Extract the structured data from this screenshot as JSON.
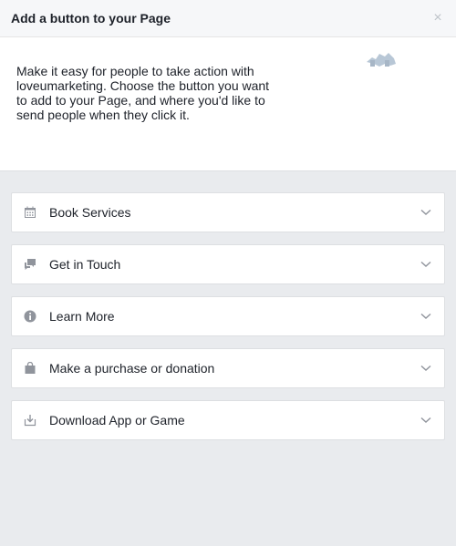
{
  "dialog": {
    "title": "Add a button to your Page",
    "close_label": "×",
    "intro_text": "Make it easy for people to take action with loveumarketing. Choose the button you want to add to your Page, and where you'd like to send people when they click it."
  },
  "options": [
    {
      "label": "Book Services",
      "icon": "calendar-icon"
    },
    {
      "label": "Get in Touch",
      "icon": "chat-icon"
    },
    {
      "label": "Learn More",
      "icon": "info-icon"
    },
    {
      "label": "Make a purchase or donation",
      "icon": "shopping-bag-icon"
    },
    {
      "label": "Download App or Game",
      "icon": "download-icon"
    }
  ],
  "colors": {
    "icon_gray": "#90949c",
    "background": "#e9ebee",
    "card": "#ffffff"
  }
}
